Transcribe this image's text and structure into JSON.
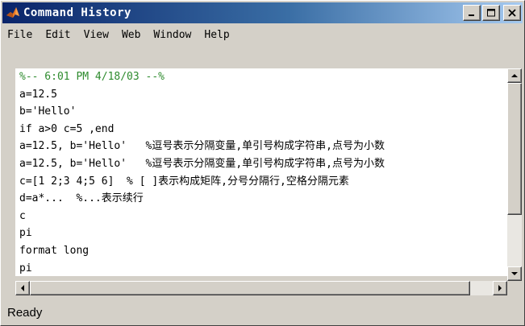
{
  "window": {
    "title": "Command History"
  },
  "menu": {
    "items": [
      "File",
      "Edit",
      "View",
      "Web",
      "Window",
      "Help"
    ]
  },
  "history": {
    "lines": [
      "%-- 6:01 PM 4/18/03 --%",
      "a=12.5",
      "b='Hello'",
      "if a>0 c=5 ,end",
      "a=12.5, b='Hello'   %逗号表示分隔变量,单引号构成字符串,点号为小数",
      "a=12.5, b='Hello'   %逗号表示分隔变量,单引号构成字符串,点号为小数",
      "c=[1 2;3 4;5 6]  % [ ]表示构成矩阵,分号分隔行,空格分隔元素",
      "d=a*...  %...表示续行",
      "c",
      "pi",
      "format long",
      "pi"
    ]
  },
  "status": {
    "text": "Ready"
  },
  "colors": {
    "title_start": "#0a246a",
    "title_end": "#a6caf0",
    "session_marker": "#2e8b2e",
    "chrome": "#d4d0c8"
  }
}
